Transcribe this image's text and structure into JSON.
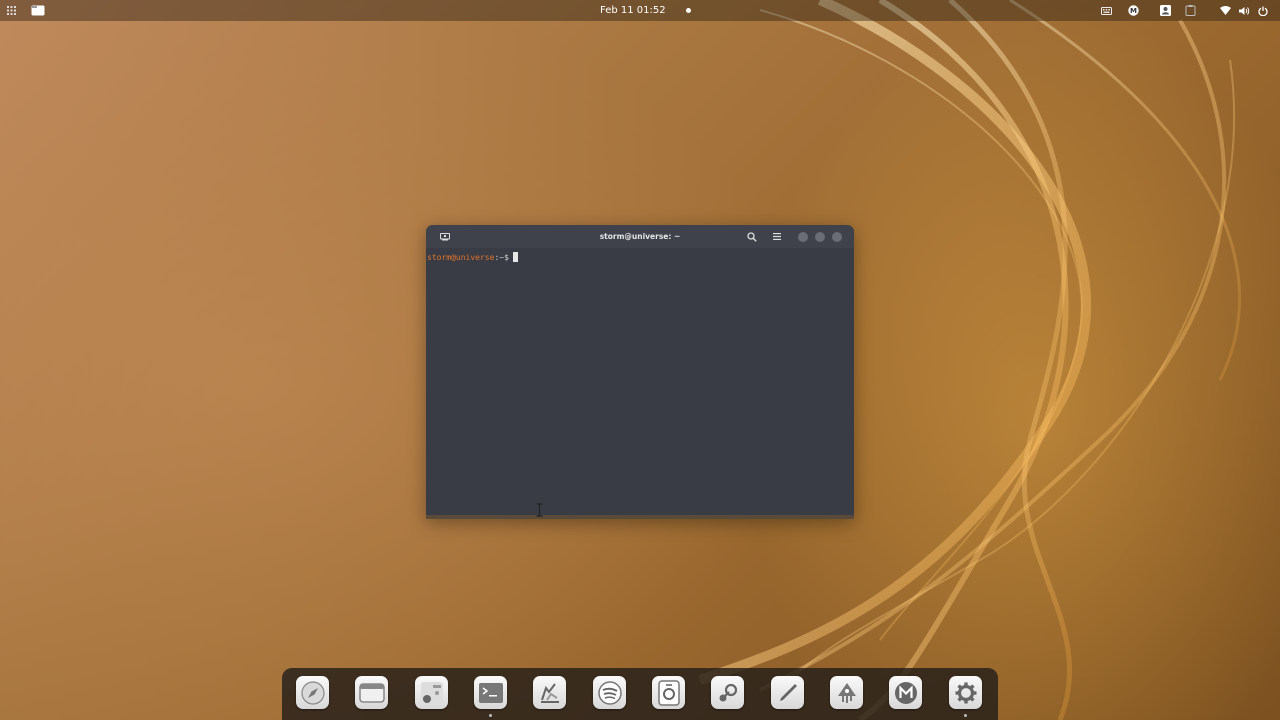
{
  "topbar": {
    "clock": "Feb 11  01:52",
    "left_icons": [
      "apps-grid-icon",
      "window-icon"
    ],
    "right_icons": [
      "keyboard-icon",
      "mega-sync-icon",
      "user-icon",
      "clipboard-icon",
      "wifi-icon",
      "volume-icon",
      "power-icon"
    ]
  },
  "terminal": {
    "title": "storm@universe: ~",
    "prompt_user": "storm@universe",
    "prompt_path": ":~$"
  },
  "dock": {
    "items": [
      {
        "name": "safari-compass-icon",
        "running": false
      },
      {
        "name": "files-window-icon",
        "running": false
      },
      {
        "name": "gnome-tweaks-icon",
        "running": false
      },
      {
        "name": "terminal-icon",
        "running": true
      },
      {
        "name": "chart-app-icon",
        "running": false
      },
      {
        "name": "spotify-icon",
        "running": false
      },
      {
        "name": "camera-app-icon",
        "running": false
      },
      {
        "name": "steam-icon",
        "running": false
      },
      {
        "name": "inkscape-pen-icon",
        "running": false
      },
      {
        "name": "graphics-editor-icon",
        "running": false
      },
      {
        "name": "mega-icon",
        "running": false
      },
      {
        "name": "settings-gear-icon",
        "running": true
      }
    ]
  },
  "colors": {
    "prompt_user": "#e0742a",
    "terminal_bg": "#393c45"
  }
}
